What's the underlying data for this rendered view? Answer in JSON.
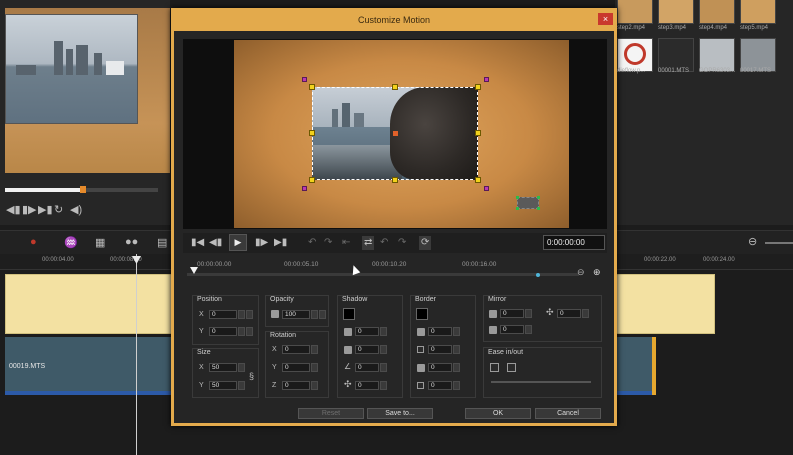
{
  "dialog": {
    "title": "Customize Motion",
    "close": "×",
    "timecode": "0:00:00:00",
    "buttons": {
      "reset": "Reset",
      "save_to": "Save to...",
      "ok": "OK",
      "cancel": "Cancel"
    },
    "keyframe_ruler": [
      "00:00:00.00",
      "00:00:05.10",
      "00:00:10.20",
      "00:00:16.00"
    ]
  },
  "panels": {
    "position": {
      "label": "Position",
      "x_label": "X",
      "x": "0",
      "y_label": "Y",
      "y": "0"
    },
    "size": {
      "label": "Size",
      "x_label": "X",
      "x": "50",
      "y_label": "Y",
      "y": "50"
    },
    "opacity": {
      "label": "Opacity",
      "value": "100"
    },
    "rotation": {
      "label": "Rotation",
      "x_label": "X",
      "x": "0",
      "y_label": "Y",
      "y": "0",
      "z_label": "Z",
      "z": "0"
    },
    "shadow": {
      "label": "Shadow",
      "v1": "0",
      "v2": "0",
      "v3": "0",
      "v4": "0"
    },
    "border": {
      "label": "Border",
      "v1": "0",
      "v2": "0",
      "v3": "0",
      "v4": "0"
    },
    "mirror": {
      "label": "Mirror",
      "v1": "0",
      "v2": "0",
      "v3": "0"
    },
    "ease": {
      "label": "Ease in/out"
    }
  },
  "library": {
    "thumbs": [
      "step2.mp4",
      "step3.mp4",
      "step4.mp4",
      "step5.mp4",
      "dieflow.p...",
      "00001.MTS",
      "GOPR6303...",
      "00017.MTS"
    ]
  },
  "timeline": {
    "ruler": [
      "00:00:04.00",
      "00:00:08.00",
      "00:00:22.00",
      "00:00:24.00"
    ],
    "clip_label": "00019.MTS"
  }
}
